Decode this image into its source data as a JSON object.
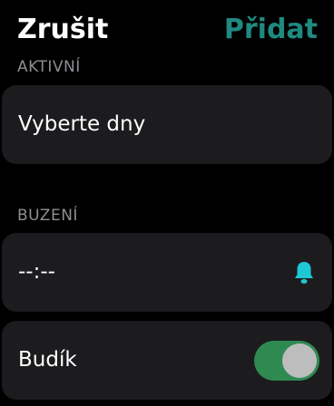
{
  "header": {
    "cancel_label": "Zrušit",
    "add_label": "Přidat"
  },
  "active_section": {
    "label": "AKTIVNÍ",
    "days_label": "Vyberte dny"
  },
  "wake_section": {
    "label": "BUZENÍ",
    "time_value": "--:--",
    "bell_icon": "bell-icon"
  },
  "alarm_row": {
    "label": "Budík",
    "toggle_on": true
  },
  "colors": {
    "accent": "#1f8a80",
    "bell": "#1ec8d3",
    "toggle_on": "#2f8a52",
    "card_bg": "#1c1c1e",
    "secondary_text": "#8e8e93"
  }
}
